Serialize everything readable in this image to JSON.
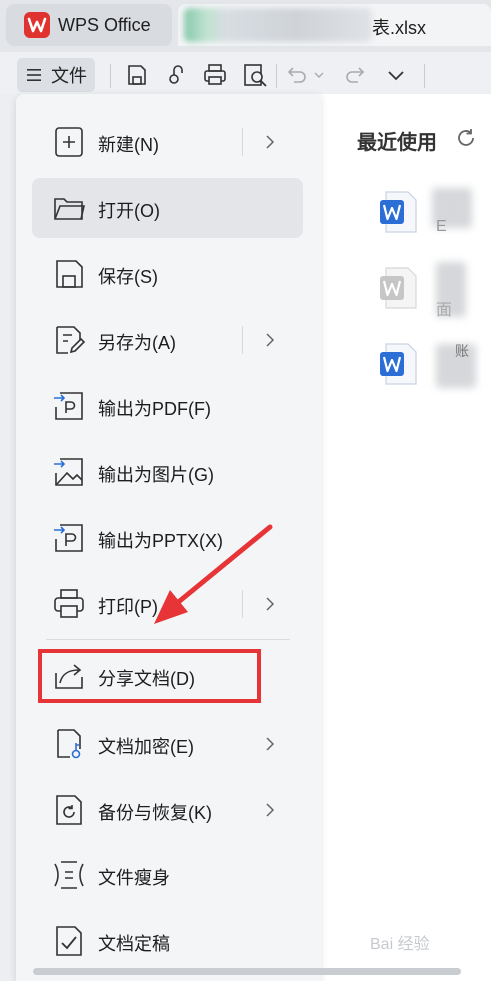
{
  "app": {
    "title": "WPS Office"
  },
  "tab": {
    "filename": "表.xlsx"
  },
  "toolbar": {
    "menu_label": "文件"
  },
  "menu": {
    "items": [
      {
        "label": "新建(N)",
        "icon": "new-document-icon",
        "has_submenu": true
      },
      {
        "label": "打开(O)",
        "icon": "folder-open-icon",
        "has_submenu": false
      },
      {
        "label": "保存(S)",
        "icon": "save-icon",
        "has_submenu": false
      },
      {
        "label": "另存为(A)",
        "icon": "save-as-icon",
        "has_submenu": true
      },
      {
        "label": "输出为PDF(F)",
        "icon": "export-pdf-icon",
        "has_submenu": false
      },
      {
        "label": "输出为图片(G)",
        "icon": "export-image-icon",
        "has_submenu": false
      },
      {
        "label": "输出为PPTX(X)",
        "icon": "export-pptx-icon",
        "has_submenu": false
      },
      {
        "label": "打印(P)",
        "icon": "print-icon",
        "has_submenu": true
      },
      {
        "label": "分享文档(D)",
        "icon": "share-icon",
        "has_submenu": false
      },
      {
        "label": "文档加密(E)",
        "icon": "encrypt-icon",
        "has_submenu": true
      },
      {
        "label": "备份与恢复(K)",
        "icon": "backup-icon",
        "has_submenu": true
      },
      {
        "label": "文件瘦身",
        "icon": "slim-file-icon",
        "has_submenu": false
      },
      {
        "label": "文档定稿",
        "icon": "finalize-icon",
        "has_submenu": false
      }
    ]
  },
  "recent": {
    "title": "最近使用",
    "docs": [
      {
        "snippet": "E"
      },
      {
        "snippet": "面"
      },
      {
        "snippet": "账"
      }
    ]
  },
  "watermark": "Bai 经验",
  "colors": {
    "wps_red": "#e0322f",
    "highlight": "#e63437",
    "doc_blue": "#2b6fd6"
  }
}
